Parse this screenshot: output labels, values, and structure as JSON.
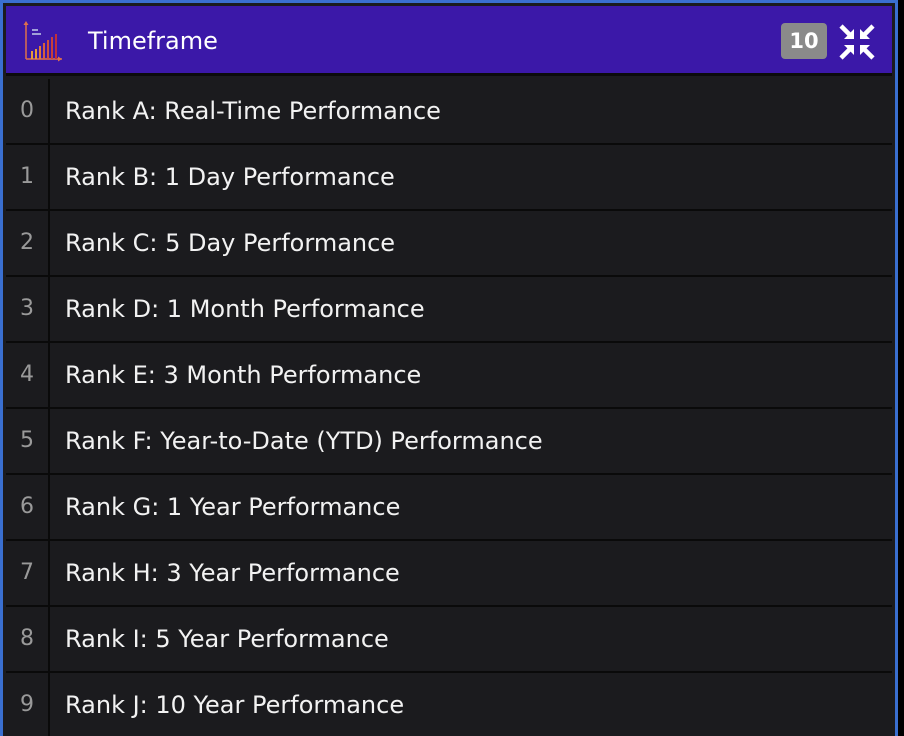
{
  "header": {
    "title": "Timeframe",
    "count": "10",
    "icon": "bar-chart-icon",
    "action_icon": "collapse-arrows-icon"
  },
  "colors": {
    "header_bg": "#3b18a8",
    "frame_border": "#3a6fd0",
    "row_bg": "#1b1b1e",
    "badge_bg": "#8a8a8a"
  },
  "items": [
    {
      "index": "0",
      "label": "Rank A: Real-Time Performance"
    },
    {
      "index": "1",
      "label": "Rank B: 1 Day Performance"
    },
    {
      "index": "2",
      "label": "Rank C: 5 Day Performance"
    },
    {
      "index": "3",
      "label": "Rank D: 1 Month Performance"
    },
    {
      "index": "4",
      "label": "Rank E: 3 Month Performance"
    },
    {
      "index": "5",
      "label": "Rank F: Year-to-Date (YTD) Performance"
    },
    {
      "index": "6",
      "label": "Rank G: 1 Year Performance"
    },
    {
      "index": "7",
      "label": "Rank H: 3 Year Performance"
    },
    {
      "index": "8",
      "label": "Rank I: 5 Year Performance"
    },
    {
      "index": "9",
      "label": "Rank J: 10 Year Performance"
    }
  ]
}
